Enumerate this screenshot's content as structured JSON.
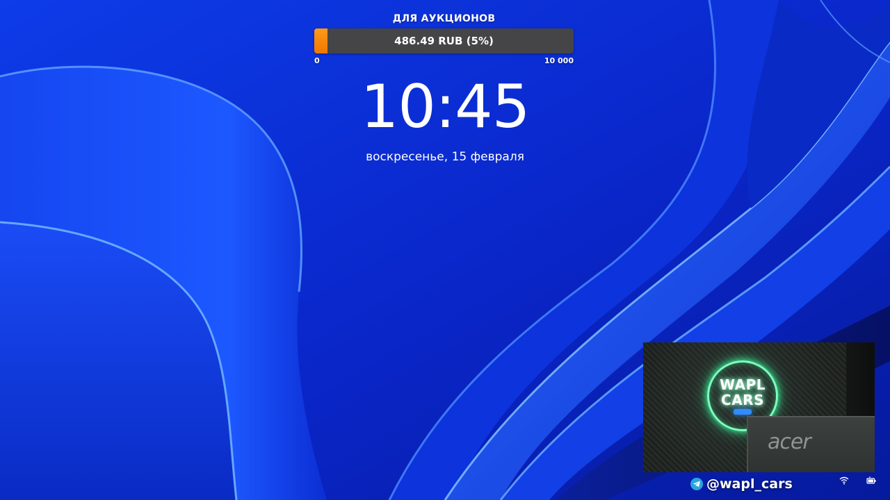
{
  "goal": {
    "title": "ДЛЯ АУКЦИОНОВ",
    "progress_text": "486.49 RUB (5%)",
    "progress_fraction": 0.05,
    "min_label": "0",
    "max_label": "10 000",
    "fill_color": "#f28a0c",
    "track_color": "#454547"
  },
  "lock_screen": {
    "time": "10:45",
    "date": "воскресенье, 15 февраля"
  },
  "webcam": {
    "logo_line1": "WAPL",
    "logo_line2": "CARS",
    "monitor_brand": "acer"
  },
  "social": {
    "icon": "telegram-icon",
    "handle": "@wapl_cars"
  },
  "tray": {
    "icons": [
      "wifi-icon",
      "battery-icon"
    ]
  },
  "colors": {
    "wallpaper_base": "#0a2bd8",
    "neon_green": "#39f59a"
  }
}
